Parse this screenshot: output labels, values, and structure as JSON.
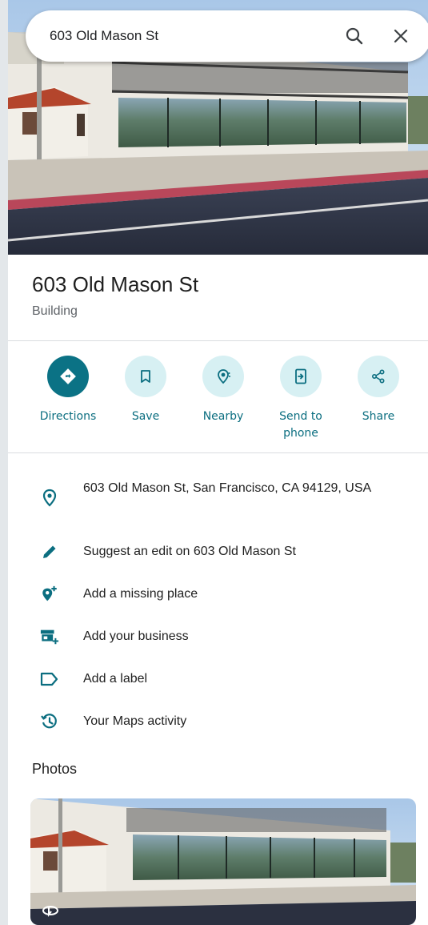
{
  "search": {
    "query": "603 Old Mason St"
  },
  "place": {
    "name": "603 Old Mason St",
    "category": "Building"
  },
  "actions": [
    {
      "label": "Directions",
      "icon": "directions-icon"
    },
    {
      "label": "Save",
      "icon": "bookmark-icon"
    },
    {
      "label": "Nearby",
      "icon": "nearby-icon"
    },
    {
      "label": "Send to\nphone",
      "icon": "send-to-phone-icon"
    },
    {
      "label": "Share",
      "icon": "share-icon"
    }
  ],
  "info": [
    {
      "text": "603 Old Mason St, San Francisco, CA 94129, USA",
      "icon": "location-pin-icon"
    },
    {
      "text": "Suggest an edit on 603 Old Mason St",
      "icon": "pencil-icon"
    },
    {
      "text": "Add a missing place",
      "icon": "add-place-icon"
    },
    {
      "text": "Add your business",
      "icon": "add-business-icon"
    },
    {
      "text": "Add a label",
      "icon": "label-icon"
    },
    {
      "text": "Your Maps activity",
      "icon": "history-icon"
    }
  ],
  "photos": {
    "heading": "Photos"
  },
  "colors": {
    "accent": "#0b7285",
    "accent_light": "#d7f0f3",
    "text_accent": "#0b6e80"
  }
}
